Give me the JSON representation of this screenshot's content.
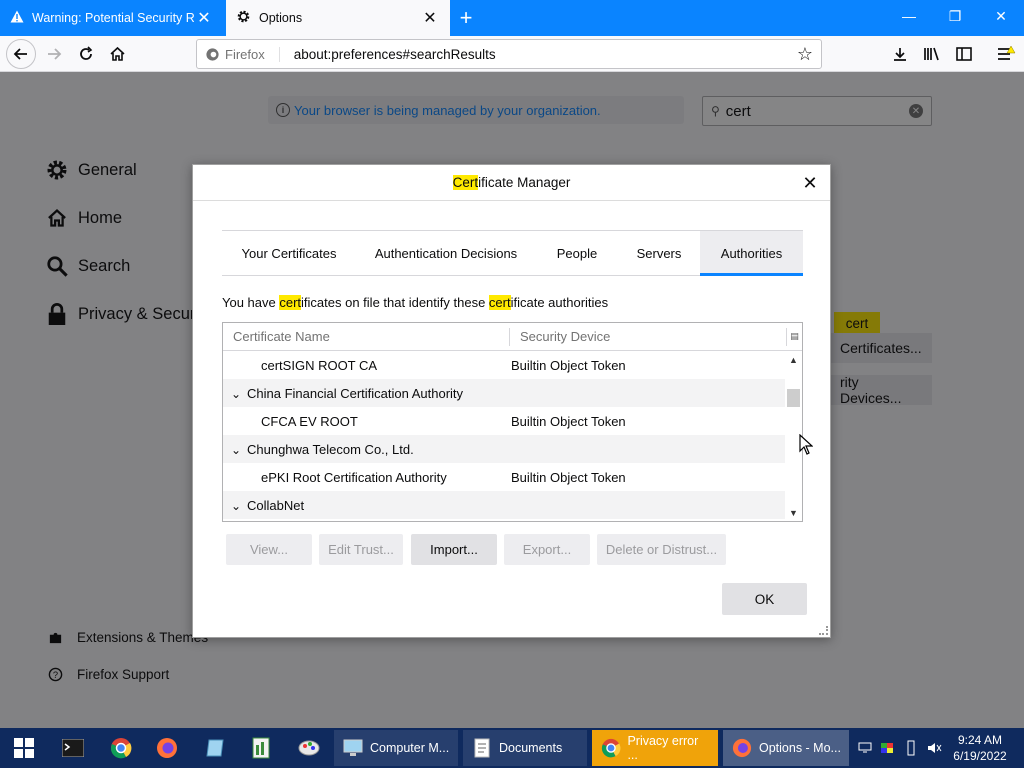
{
  "browser": {
    "tabs": [
      {
        "title": "Warning: Potential Security Risk",
        "icon": "warning-icon",
        "active": false
      },
      {
        "title": "Options",
        "icon": "gear-icon",
        "active": true
      }
    ],
    "url_identity": "Firefox",
    "url": "about:preferences#searchResults"
  },
  "prefs": {
    "managed_notice": "Your browser is being managed by your organization.",
    "search_value": "cert",
    "categories": [
      "General",
      "Home",
      "Search",
      "Privacy & Security"
    ],
    "footer": [
      "Extensions & Themes",
      "Firefox Support"
    ],
    "search_badge": "cert",
    "view_certificates_button": "Certificates...",
    "security_devices_button": "rity Devices..."
  },
  "dialog": {
    "title_highlight": "Cert",
    "title_rest": "ificate Manager",
    "tabs": [
      "Your Certificates",
      "Authentication Decisions",
      "People",
      "Servers",
      "Authorities"
    ],
    "selected_tab": "Authorities",
    "description": {
      "p1": "You have ",
      "h1": "cert",
      "p2": "ificates on file that identify these ",
      "h2": "cert",
      "p3": "ificate authorities"
    },
    "columns": [
      "Certificate Name",
      "Security Device"
    ],
    "rows": [
      {
        "name": "certSIGN ROOT CA",
        "device": "Builtin Object Token"
      },
      {
        "name": "China Financial Certification Authority",
        "device": ""
      },
      {
        "name": "CFCA EV ROOT",
        "device": "Builtin Object Token"
      },
      {
        "name": "Chunghwa Telecom Co., Ltd.",
        "device": ""
      },
      {
        "name": "ePKI Root Certification Authority",
        "device": "Builtin Object Token"
      },
      {
        "name": "CollabNet",
        "device": ""
      }
    ],
    "buttons": {
      "view": "View...",
      "edit_trust": "Edit Trust...",
      "import": "Import...",
      "export": "Export...",
      "delete": "Delete or Distrust..."
    },
    "ok": "OK"
  },
  "taskbar": {
    "tasks": [
      "Computer M...",
      "Documents",
      "Privacy error ...",
      "Options - Mo..."
    ],
    "time": "9:24 AM",
    "date": "6/19/2022"
  },
  "colors": {
    "accent": "#0a84ff",
    "highlight": "#ffe900",
    "taskbar": "#0f2a5e",
    "flash_task": "#f0a30a"
  }
}
